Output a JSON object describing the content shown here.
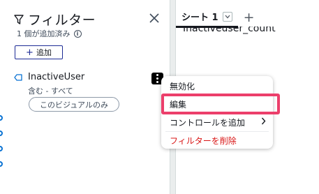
{
  "filter_panel": {
    "title": "フィルター",
    "subtitle": "1 個が追加済み",
    "add_button": "追加",
    "filter": {
      "name": "InactiveUser",
      "condition": "含む - すべて",
      "scope": "このビジュアルのみ"
    }
  },
  "sheet": {
    "tab_label": "シート 1",
    "visual_title": "Inactiveuser_count"
  },
  "context_menu": {
    "items": [
      {
        "label": "無効化"
      },
      {
        "label": "編集"
      },
      {
        "label": "コントロールを追加"
      },
      {
        "label": "フィルターを削除"
      }
    ]
  },
  "colors": {
    "highlight": "#ec3f6b",
    "danger": "#d91515",
    "accent": "#1d2b95"
  },
  "icons": [
    "filter-icon",
    "close-icon",
    "info-icon",
    "plus-icon",
    "tag-icon",
    "more-vertical-icon",
    "chevron-down-icon",
    "plus-icon",
    "chevron-right-icon"
  ]
}
